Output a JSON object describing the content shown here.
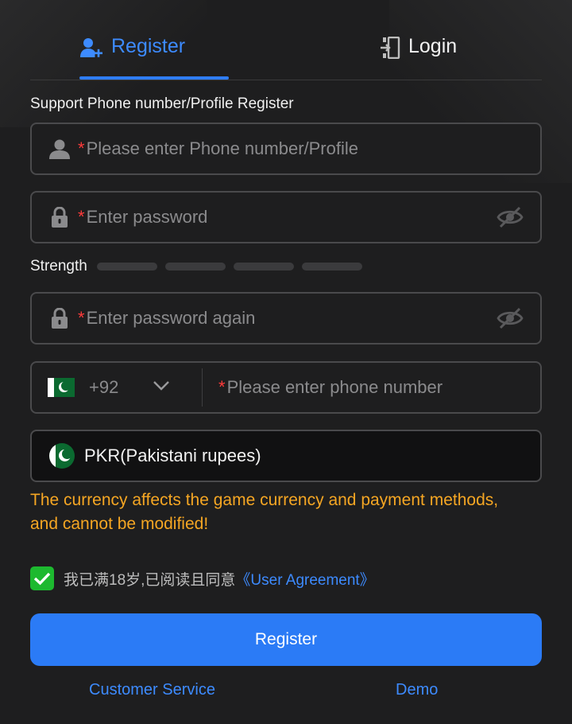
{
  "tabs": {
    "register": "Register",
    "login": "Login"
  },
  "form": {
    "support_label": "Support Phone number/Profile Register",
    "profile_placeholder": "Please enter Phone number/Profile",
    "password_placeholder": "Enter password",
    "strength_label": "Strength",
    "password_again_placeholder": "Enter password again",
    "country_code": "+92",
    "phone_placeholder": "Please enter phone number",
    "required_mark": "*"
  },
  "currency": {
    "label": "PKR(Pakistani rupees)",
    "warning": "The currency affects the game currency and payment methods, and cannot be modified!"
  },
  "agreement": {
    "checked": true,
    "text": "我已满18岁,已阅读且同意",
    "link": "《User Agreement》"
  },
  "actions": {
    "register_button": "Register",
    "customer_service": "Customer Service",
    "demo": "Demo"
  },
  "colors": {
    "accent": "#2b7bf6",
    "warning": "#f5a623",
    "required": "#ff3b3b",
    "checkbox": "#1db92f"
  },
  "icons": {
    "register_tab": "add-user-icon",
    "login_tab": "login-door-icon",
    "profile": "user-icon",
    "password": "lock-icon",
    "visibility": "eye-off-icon",
    "dropdown": "chevron-down-icon",
    "flag": "pakistan-flag-icon"
  }
}
